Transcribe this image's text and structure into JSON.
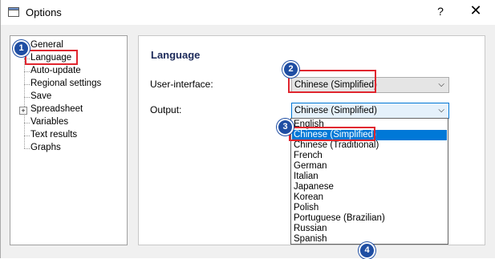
{
  "window": {
    "title": "Options",
    "help_label": "?",
    "close_label": "✕"
  },
  "tree": {
    "items": [
      {
        "label": "General"
      },
      {
        "label": "Language"
      },
      {
        "label": "Auto-update"
      },
      {
        "label": "Regional settings"
      },
      {
        "label": "Save"
      },
      {
        "label": "Spreadsheet"
      },
      {
        "label": "Variables"
      },
      {
        "label": "Text results"
      },
      {
        "label": "Graphs"
      }
    ],
    "selected": "Language",
    "expander": "+"
  },
  "panel": {
    "title": "Language",
    "ui_label": "User-interface:",
    "ui_value": "Chinese (Simplified)",
    "output_label": "Output:",
    "output_value": "Chinese (Simplified)"
  },
  "dropdown": {
    "options": [
      "English",
      "Chinese (Simplified)",
      "Chinese (Traditional)",
      "French",
      "German",
      "Italian",
      "Japanese",
      "Korean",
      "Polish",
      "Portuguese (Brazilian)",
      "Russian",
      "Spanish"
    ],
    "selected": "Chinese (Simplified)"
  },
  "annotations": {
    "badges": [
      "1",
      "2",
      "3",
      "4"
    ],
    "highlight_color": "#e0262f",
    "badge_color": "#1f4ea3"
  },
  "colors": {
    "selection": "#0078d7"
  }
}
